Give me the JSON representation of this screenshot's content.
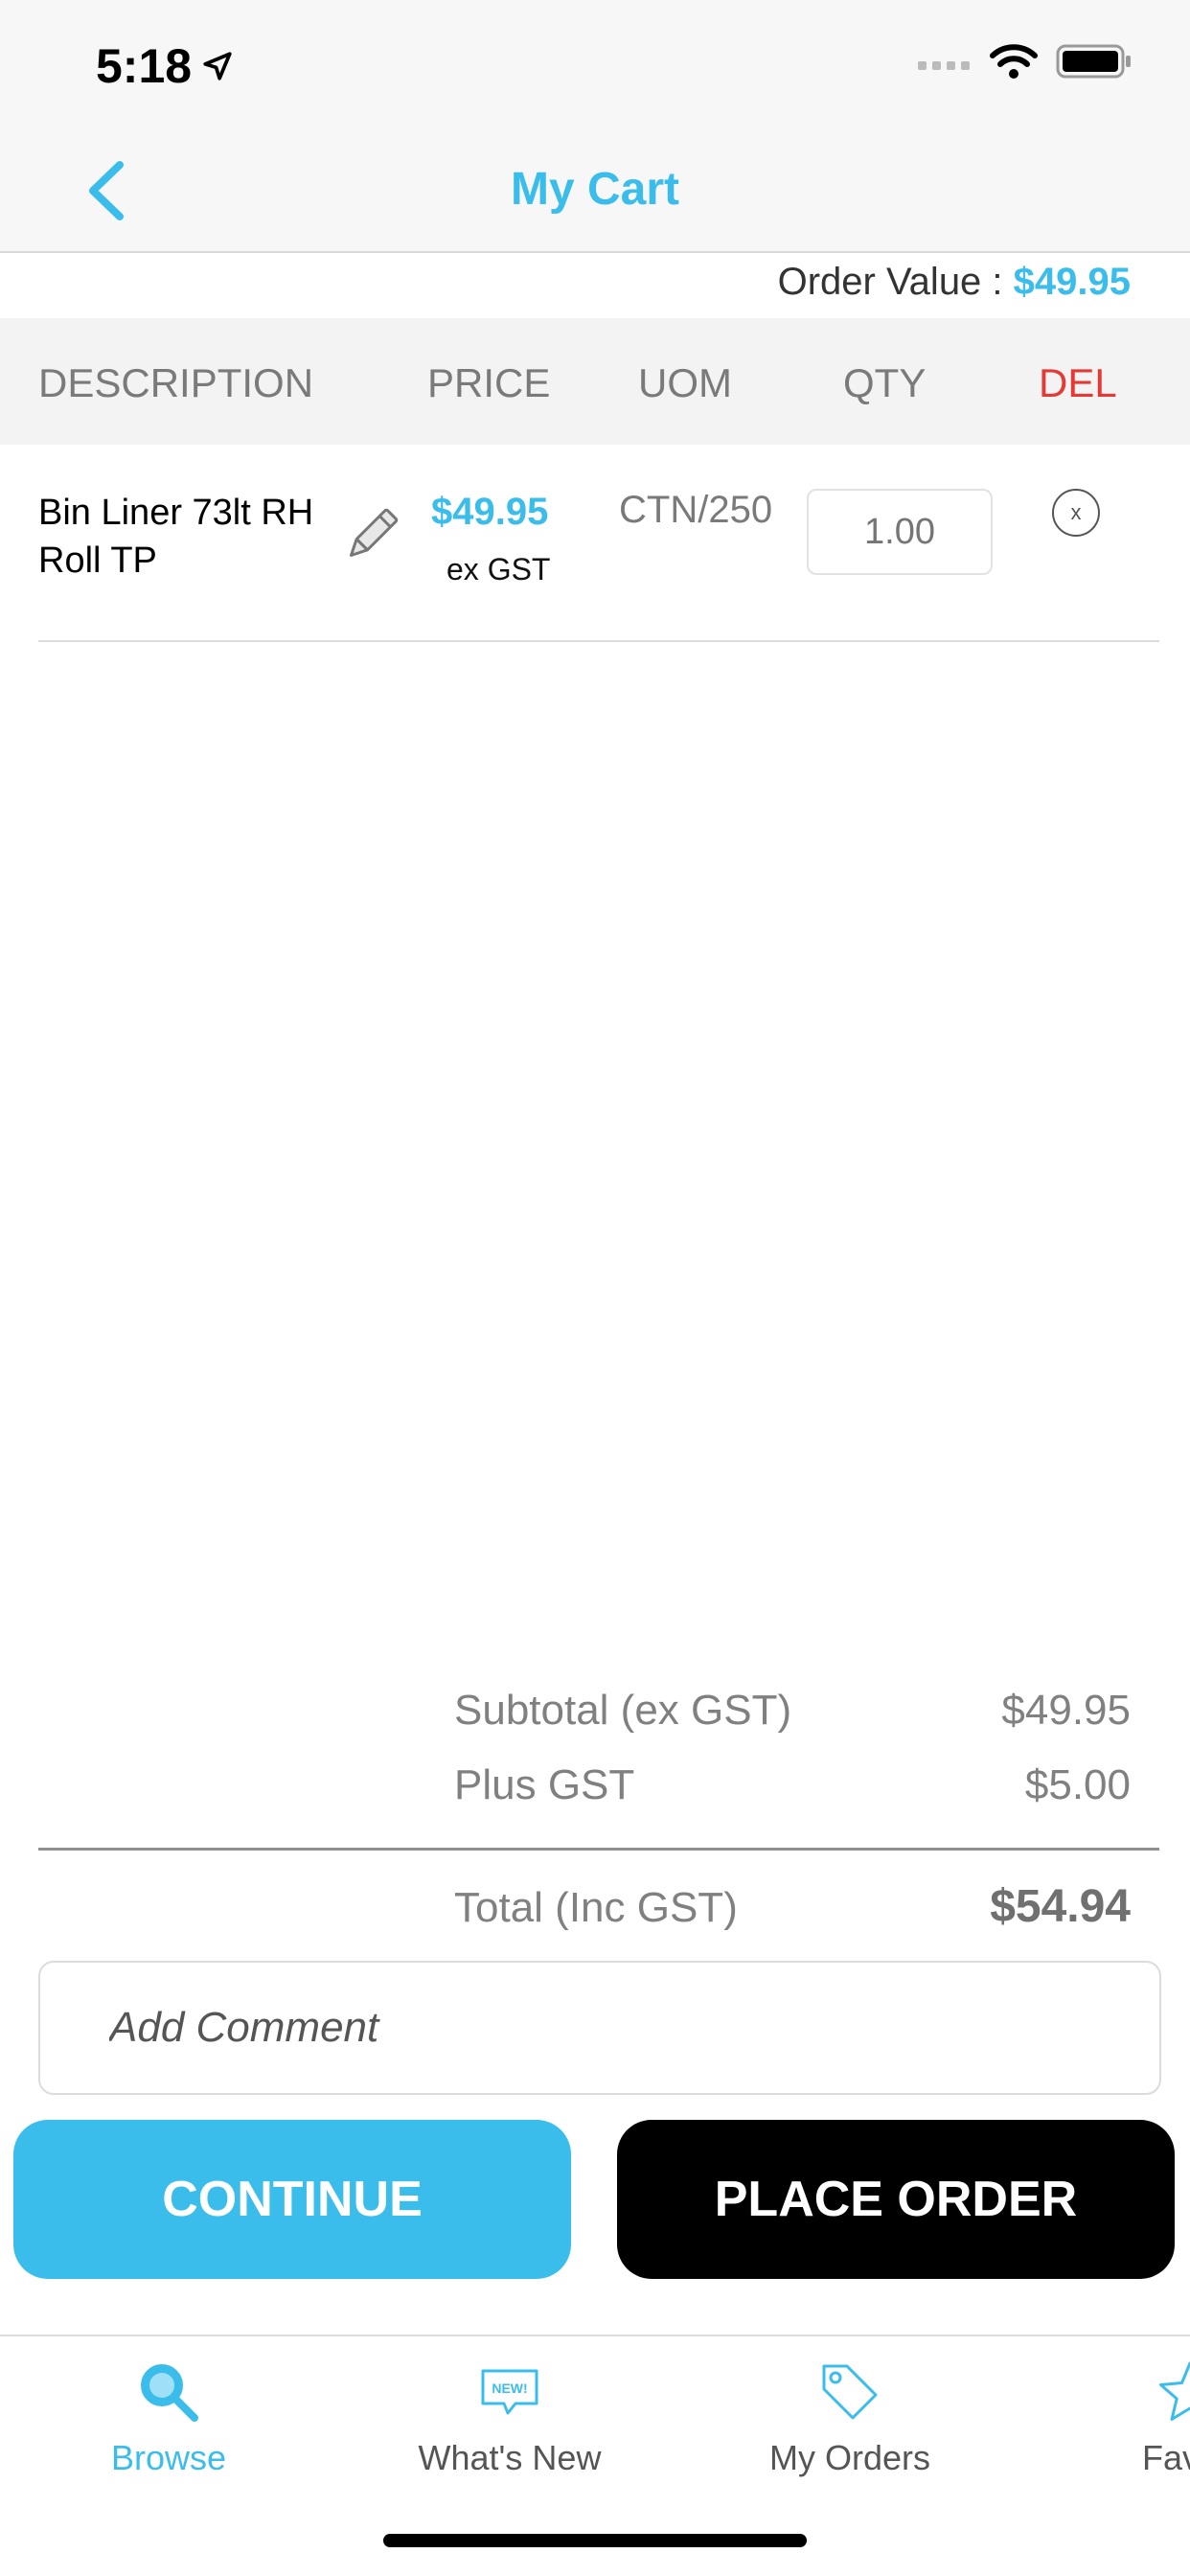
{
  "status": {
    "time": "5:18"
  },
  "nav": {
    "title": "My Cart"
  },
  "order": {
    "label": "Order Value :",
    "value": "$49.95"
  },
  "table": {
    "headers": {
      "description": "DESCRIPTION",
      "price": "PRICE",
      "uom": "UOM",
      "qty": "QTY",
      "del": "DEL"
    },
    "items": [
      {
        "description": "Bin Liner 73lt RH Roll TP",
        "price": "$49.95",
        "price_note": "ex GST",
        "uom": "CTN/250",
        "qty_placeholder": "1.00",
        "del_symbol": "x"
      }
    ]
  },
  "totals": {
    "subtotal_label": "Subtotal (ex GST)",
    "subtotal_value": "$49.95",
    "gst_label": "Plus GST",
    "gst_value": "$5.00",
    "total_label": "Total (Inc GST)",
    "total_value": "$54.94"
  },
  "comment": {
    "placeholder": "Add Comment"
  },
  "actions": {
    "continue_label": "CONTINUE",
    "place_order_label": "PLACE ORDER"
  },
  "tabs": [
    {
      "label": "Browse",
      "icon": "search-icon",
      "active": true
    },
    {
      "label": "What's New",
      "icon": "new-badge-icon",
      "badge": "NEW!"
    },
    {
      "label": "My Orders",
      "icon": "tag-icon"
    },
    {
      "label": "Favou",
      "icon": "star-icon"
    }
  ],
  "colors": {
    "accent": "#3bbdec",
    "danger": "#e53935",
    "dark": "#000000"
  }
}
